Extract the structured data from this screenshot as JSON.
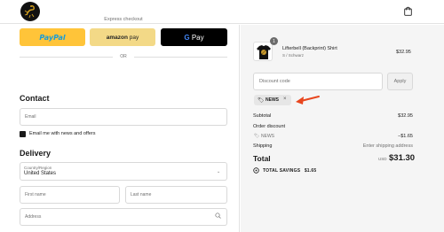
{
  "header": {
    "logo_icon": "scorpion-logo-icon",
    "cart_icon": "shopping-bag-icon"
  },
  "express": {
    "title": "Express checkout",
    "or_text": "OR",
    "paypal_a": "Pay",
    "paypal_b": "Pal",
    "amazon_a": "amazon",
    "amazon_b": " pay",
    "gpay_g": "G",
    "gpay_text": " Pay"
  },
  "contact": {
    "heading": "Contact",
    "email_placeholder": "Email",
    "news_label": "Email me with news and offers",
    "news_checked": true
  },
  "delivery": {
    "heading": "Delivery",
    "country_label": "Country/Region",
    "country_value": "United States",
    "first_name_placeholder": "First name",
    "last_name_placeholder": "Last name",
    "address_placeholder": "Address"
  },
  "order": {
    "quantity": "1",
    "product_name": "Lifterbell (Backprint) Shirt",
    "product_variant": "S / Schwarz",
    "product_price": "$32.95",
    "discount_placeholder": "Discount code",
    "apply_label": "Apply",
    "discount_tag": "NEWS",
    "subtotal_label": "Subtotal",
    "subtotal_value": "$32.95",
    "order_discount_label": "Order discount",
    "discount_code": "NEWS",
    "discount_value": "−$1.65",
    "shipping_label": "Shipping",
    "shipping_value": "Enter shipping address",
    "total_label": "Total",
    "currency": "USD",
    "total_value": "$31.30",
    "savings_label": "TOTAL SAVINGS",
    "savings_value": "$1.65"
  },
  "colors": {
    "paypal": "#ffc439",
    "amazon": "#f3d987",
    "gpay": "#000000",
    "arrow": "#e8461e"
  }
}
